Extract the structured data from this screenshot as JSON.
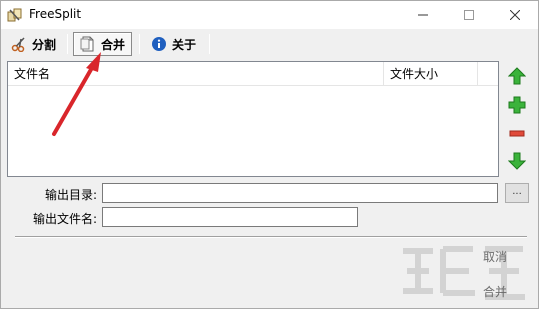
{
  "window": {
    "title": "FreeSplit",
    "minimize_label": "—",
    "maximize_label": "☐",
    "close_label": "✕"
  },
  "tabs": [
    {
      "label": "分割",
      "icon": "scissors-icon"
    },
    {
      "label": "合并",
      "icon": "document-icon",
      "active": true
    },
    {
      "label": "关于",
      "icon": "info-icon"
    }
  ],
  "file_list": {
    "columns": [
      "文件名",
      "文件大小"
    ],
    "rows": []
  },
  "side_buttons": [
    {
      "name": "move-up",
      "icon": "arrow-up-icon",
      "color": "#2ea82e"
    },
    {
      "name": "add",
      "icon": "plus-icon",
      "color": "#2ea82e"
    },
    {
      "name": "remove",
      "icon": "minus-icon",
      "color": "#d93a2b"
    },
    {
      "name": "move-down",
      "icon": "arrow-down-icon",
      "color": "#2ea82e"
    }
  ],
  "form": {
    "output_dir_label": "输出目录:",
    "output_dir_value": "",
    "output_name_label": "输出文件名:",
    "output_name_value": "",
    "browse_label": "..."
  },
  "actions": {
    "cancel_label": "取消",
    "merge_label": "合并"
  },
  "annotation": {
    "arrow_color": "#d9262b"
  }
}
